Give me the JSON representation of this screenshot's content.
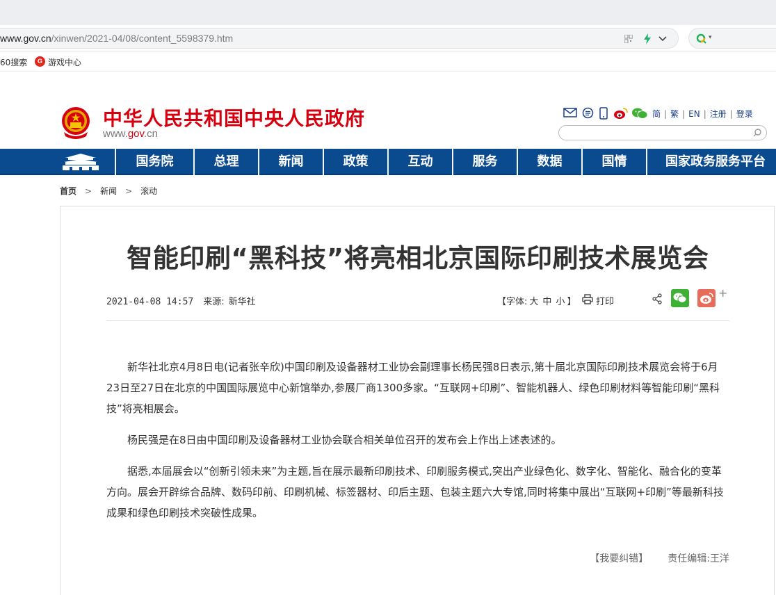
{
  "browser": {
    "url_host": "www.gov.cn",
    "url_path": "/xinwen/2021-04/08/content_5598379.htm",
    "search_caret": "▾",
    "bookmarks": [
      {
        "label": "60搜索"
      },
      {
        "label": "游戏中心",
        "icon_text": "G"
      }
    ]
  },
  "site": {
    "name": "中华人民共和国中央人民政府",
    "domain_prefix": "www.",
    "domain_main": "gov",
    "domain_suffix": ".cn",
    "lang_links": [
      "简",
      "繁",
      "EN",
      "注册",
      "登录"
    ],
    "lang_sep": "|",
    "search_placeholder": ""
  },
  "nav": {
    "items": [
      "国务院",
      "总理",
      "新闻",
      "政策",
      "互动",
      "服务",
      "数据",
      "国情",
      "国家政务服务平台"
    ]
  },
  "breadcrumb": [
    "首页",
    "新闻",
    "滚动"
  ],
  "breadcrumb_sep": ">",
  "article": {
    "title": "智能印刷“黑科技”将亮相北京国际印刷技术展览会",
    "datetime": "2021-04-08 14:57",
    "source_label": "来源:",
    "source": "新华社",
    "font_label": "【字体:",
    "font_options": [
      "大",
      "中",
      "小"
    ],
    "font_close": "】",
    "print_label": "打印",
    "plus": "+",
    "paragraphs": [
      "新华社北京4月8日电(记者张辛欣)中国印刷及设备器材工业协会副理事长杨民强8日表示,第十届北京国际印刷技术展览会将于6月23日至27日在北京的中国国际展览中心新馆举办,参展厂商1300多家。“互联网+印刷”、智能机器人、绿色印刷材料等智能印刷“黑科技”将亮相展会。",
      "杨民强是在8日由中国印刷及设备器材工业协会联合相关单位召开的发布会上作出上述表述的。",
      "据悉,本届展会以“创新引领未来”为主题,旨在展示最新印刷技术、印刷服务模式,突出产业绿色化、数字化、智能化、融合化的变革方向。展会开辟综合品牌、数码印前、印刷机械、标签器材、印后主题、包装主题六大专馆,同时将集中展出“互联网+印刷”等最新科技成果和绿色印刷技术突破性成果。"
    ],
    "correction": "【我要纠错】",
    "editor": "责任编辑:王洋"
  },
  "colors": {
    "brand_red": "#d6000f",
    "nav_blue": "#0a4b8f",
    "wechat_green": "#3eb135",
    "weibo_red": "#e76d5a"
  }
}
